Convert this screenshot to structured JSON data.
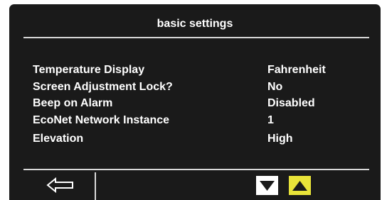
{
  "header": {
    "title": "basic settings"
  },
  "settings": [
    {
      "label": "Temperature Display",
      "value": "Fahrenheit"
    },
    {
      "label": "Screen Adjustment Lock?",
      "value": "No"
    },
    {
      "label": "Beep on Alarm",
      "value": "Disabled"
    },
    {
      "label": "EcoNet Network Instance",
      "value": "1"
    },
    {
      "label": "Elevation",
      "value": "High"
    }
  ],
  "footer": {
    "back_icon": "arrow-left-icon",
    "down_icon": "triangle-down-icon",
    "up_icon": "triangle-up-icon"
  },
  "colors": {
    "screen_background": "#1a1a1a",
    "text": "#ffffff",
    "divider": "#d9d9d9",
    "up_button": "#e8e339",
    "down_button": "#ffffff"
  }
}
